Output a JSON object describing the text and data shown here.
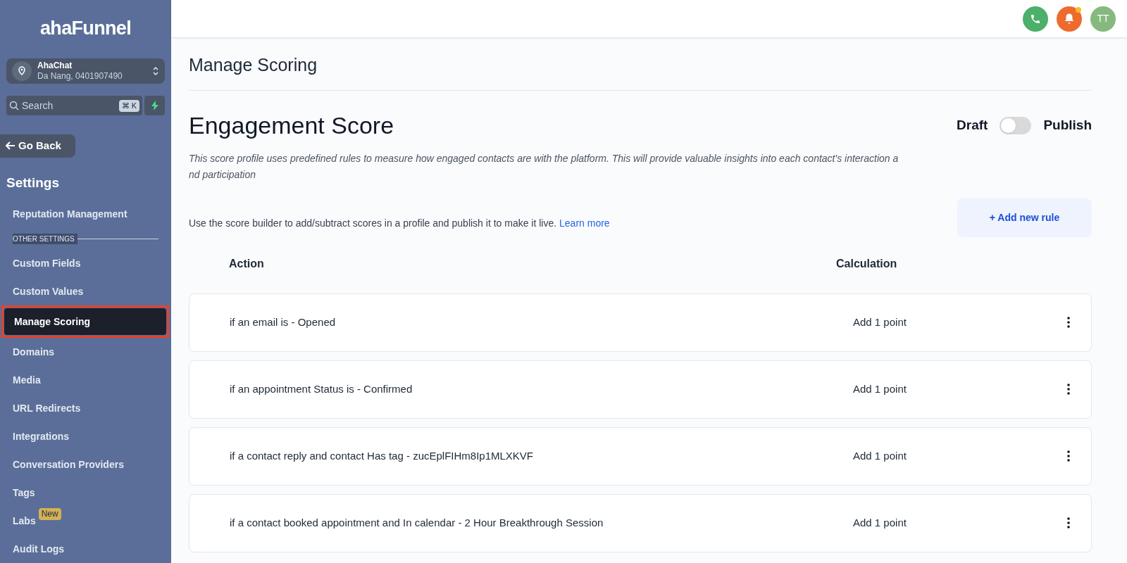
{
  "sidebar": {
    "logo": "ahaFunnel",
    "account": {
      "name": "AhaChat",
      "subtitle": "Da Nang, 0401907490"
    },
    "search": {
      "placeholder": "Search",
      "shortcut": "⌘ K"
    },
    "back_button": "Go Back",
    "section_title": "Settings",
    "items": [
      {
        "kind": "link",
        "label": "Reputation Management",
        "selected": false
      },
      {
        "kind": "divider",
        "label": "OTHER SETTINGS"
      },
      {
        "kind": "link",
        "label": "Custom Fields",
        "selected": false
      },
      {
        "kind": "link",
        "label": "Custom Values",
        "selected": false
      },
      {
        "kind": "link",
        "label": "Manage Scoring",
        "selected": true
      },
      {
        "kind": "link",
        "label": "Domains",
        "selected": false
      },
      {
        "kind": "link",
        "label": "Media",
        "selected": false
      },
      {
        "kind": "link",
        "label": "URL Redirects",
        "selected": false
      },
      {
        "kind": "link",
        "label": "Integrations",
        "selected": false
      },
      {
        "kind": "link",
        "label": "Conversation Providers",
        "selected": false
      },
      {
        "kind": "link",
        "label": "Tags",
        "selected": false
      },
      {
        "kind": "link",
        "label": "Labs",
        "selected": false,
        "badge": "New"
      },
      {
        "kind": "link",
        "label": "Audit Logs",
        "selected": false
      }
    ]
  },
  "topbar": {
    "avatar": "TT",
    "notification_dot": true
  },
  "page": {
    "title": "Manage Scoring",
    "heading": "Engagement Score",
    "toggle": {
      "off_label": "Draft",
      "on_label": "Publish",
      "on": false
    },
    "description": "This score profile uses predefined rules to measure how engaged contacts are with the platform. This will provide valuable insights into each contact's interaction and participation",
    "hint": "Use the score builder to add/subtract scores in a profile and publish it to make it live.",
    "hint_link": "Learn more",
    "add_button": "+ Add new rule",
    "table": {
      "columns": [
        "Action",
        "Calculation"
      ],
      "rows": [
        {
          "action": "if an email is - Opened",
          "calculation": "Add 1 point"
        },
        {
          "action": "if an appointment Status is - Confirmed",
          "calculation": "Add 1 point"
        },
        {
          "action": "if a contact reply and contact Has tag - zucEplFIHm8Ip1MLXKVF",
          "calculation": "Add 1 point"
        },
        {
          "action": "if a contact booked appointment and In calendar - 2 Hour Breakthrough Session",
          "calculation": "Add 1 point"
        }
      ]
    }
  }
}
